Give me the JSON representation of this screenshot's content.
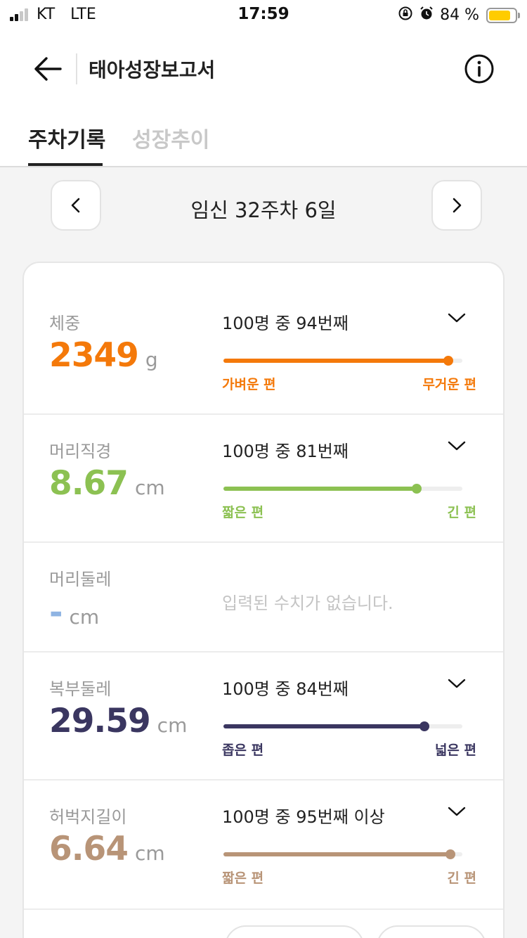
{
  "status_bar": {
    "carrier": "KT",
    "network": "LTE",
    "time": "17:59",
    "battery": "84 %",
    "battery_level": 0.84
  },
  "header": {
    "title": "태아성장보고서"
  },
  "tabs": [
    {
      "label": "주차기록",
      "active": true
    },
    {
      "label": "성장추이",
      "active": false
    }
  ],
  "week_nav": {
    "label": "임신 32주차 6일"
  },
  "measurements": [
    {
      "label": "체중",
      "value": "2349",
      "unit": "g",
      "rank": "100명 중 94번째",
      "percent": 94,
      "min_label": "가벼운 편",
      "max_label": "무거운 편",
      "color": "#f4790a"
    },
    {
      "label": "머리직경",
      "value": "8.67",
      "unit": "cm",
      "rank": "100명 중 81번째",
      "percent": 81,
      "min_label": "짧은 편",
      "max_label": "긴 편",
      "color": "#8cc152"
    },
    {
      "label": "머리둘레",
      "value": "-",
      "unit": "cm",
      "empty_message": "입력된 수치가 없습니다.",
      "color": "#8fb4e3"
    },
    {
      "label": "복부둘레",
      "value": "29.59",
      "unit": "cm",
      "rank": "100명 중 84번째",
      "percent": 84,
      "min_label": "좁은 편",
      "max_label": "넓은 편",
      "color": "#3a3660"
    },
    {
      "label": "허벅지길이",
      "value": "6.64",
      "unit": "cm",
      "rank": "100명 중 95번째 이상",
      "percent": 95,
      "min_label": "짧은 편",
      "max_label": "긴 편",
      "color": "#b89477"
    }
  ]
}
